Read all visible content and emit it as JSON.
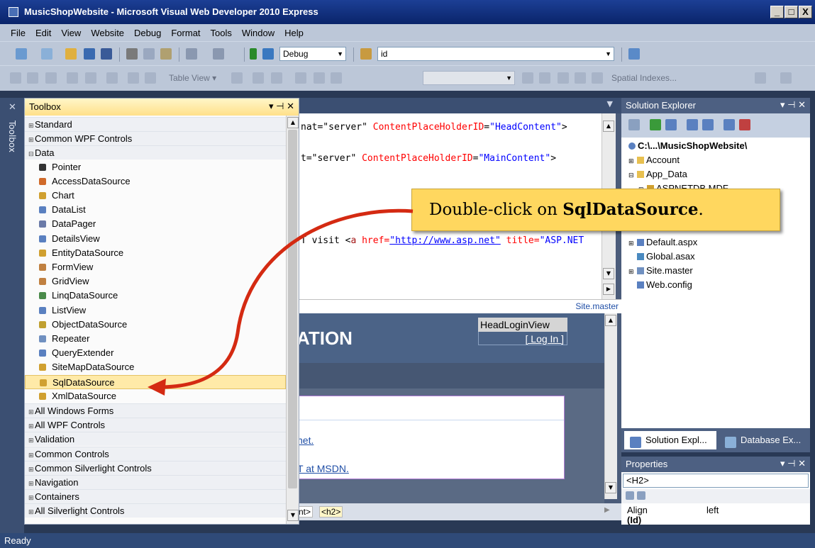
{
  "window": {
    "title": "MusicShopWebsite - Microsoft Visual Web Developer 2010 Express",
    "min": "_",
    "max": "□",
    "close": "X"
  },
  "menu": [
    "File",
    "Edit",
    "View",
    "Website",
    "Debug",
    "Format",
    "Tools",
    "Window",
    "Help"
  ],
  "toolbar": {
    "config": "Debug",
    "find": "id",
    "table_view": "Table View ▾",
    "spatial": "Spatial Indexes..."
  },
  "left_strip": {
    "toolbox_tab": "Toolbox"
  },
  "toolbox": {
    "title": "Toolbox",
    "controls": "▾ ⊣ ✕",
    "groups_top": [
      "Standard",
      "Common WPF Controls",
      "Data"
    ],
    "data_items": [
      {
        "label": "Pointer",
        "color": "#333333"
      },
      {
        "label": "AccessDataSource",
        "color": "#d06a2a"
      },
      {
        "label": "Chart",
        "color": "#d0a030"
      },
      {
        "label": "DataList",
        "color": "#5a80c0"
      },
      {
        "label": "DataPager",
        "color": "#6a7aa8"
      },
      {
        "label": "DetailsView",
        "color": "#5a80c0"
      },
      {
        "label": "EntityDataSource",
        "color": "#d0a030"
      },
      {
        "label": "FormView",
        "color": "#c08040"
      },
      {
        "label": "GridView",
        "color": "#c08040"
      },
      {
        "label": "LinqDataSource",
        "color": "#4a8a4a"
      },
      {
        "label": "ListView",
        "color": "#5a80c0"
      },
      {
        "label": "ObjectDataSource",
        "color": "#c0a030"
      },
      {
        "label": "Repeater",
        "color": "#7090c0"
      },
      {
        "label": "QueryExtender",
        "color": "#5a80c0"
      },
      {
        "label": "SiteMapDataSource",
        "color": "#d0a030"
      },
      {
        "label": "SqlDataSource",
        "color": "#d0a030"
      },
      {
        "label": "XmlDataSource",
        "color": "#d0a030"
      }
    ],
    "selected": "SqlDataSource",
    "groups_bottom": [
      "All Windows Forms",
      "All WPF Controls",
      "Validation",
      "Common Controls",
      "Common Silverlight Controls",
      "Navigation",
      "Containers",
      "All Silverlight Controls"
    ]
  },
  "editor": {
    "code": [
      {
        "pre": "nat=\"server\" ",
        "attr": "ContentPlaceHolderID",
        "eq": "=",
        "val": "\"HeadContent\"",
        "post": ">"
      },
      {
        "pre": "t=\"server\" ",
        "attr": "ContentPlaceHolderID",
        "eq": "=",
        "val": "\"MainContent\"",
        "post": ">"
      }
    ],
    "visit_pre": "T visit <",
    "visit_tag": "a",
    "visit_attr": " href=",
    "visit_link": "\"http://www.asp.net\"",
    "visit_attr2": " title=",
    "visit_val2": "\"ASP.NET",
    "site_master": "Site.master",
    "design_heading": "ATION",
    "login_title": "HeadLoginView",
    "login_link": "[ Log In ]",
    "link1": "net.",
    "link2": "T at MSDN.",
    "crumb1": "nt>",
    "crumb2": "<h2>"
  },
  "solution_explorer": {
    "title": "Solution Explorer",
    "controls": "▾ ⊣ ✕",
    "root": "C:\\...\\MusicShopWebsite\\",
    "items": [
      {
        "label": "Account",
        "prefix": "⊞",
        "color": "#e8c050"
      },
      {
        "label": "App_Data",
        "prefix": "⊟",
        "color": "#e8c050"
      },
      {
        "label": "ASPNETDB.MDF",
        "prefix": "⊞",
        "color": "#d0a030"
      }
    ],
    "items_lower": [
      {
        "label": "Default.aspx",
        "prefix": "⊞",
        "color": "#5a80c0"
      },
      {
        "label": "Global.asax",
        "prefix": "",
        "color": "#4a8ac0"
      },
      {
        "label": "Site.master",
        "prefix": "⊞",
        "color": "#7090c0"
      },
      {
        "label": "Web.config",
        "prefix": "",
        "color": "#5a80c0"
      }
    ],
    "tab_sol": "Solution Expl...",
    "tab_db": "Database Ex..."
  },
  "properties": {
    "title": "Properties",
    "controls": "▾ ⊣ ✕",
    "selected": "<H2>",
    "row_key": "Align",
    "row_val": "left",
    "row2": "(Id)"
  },
  "callout": {
    "text": "Double-click on ",
    "bold": "SqlDataSource",
    "tail": "."
  },
  "status": "Ready"
}
